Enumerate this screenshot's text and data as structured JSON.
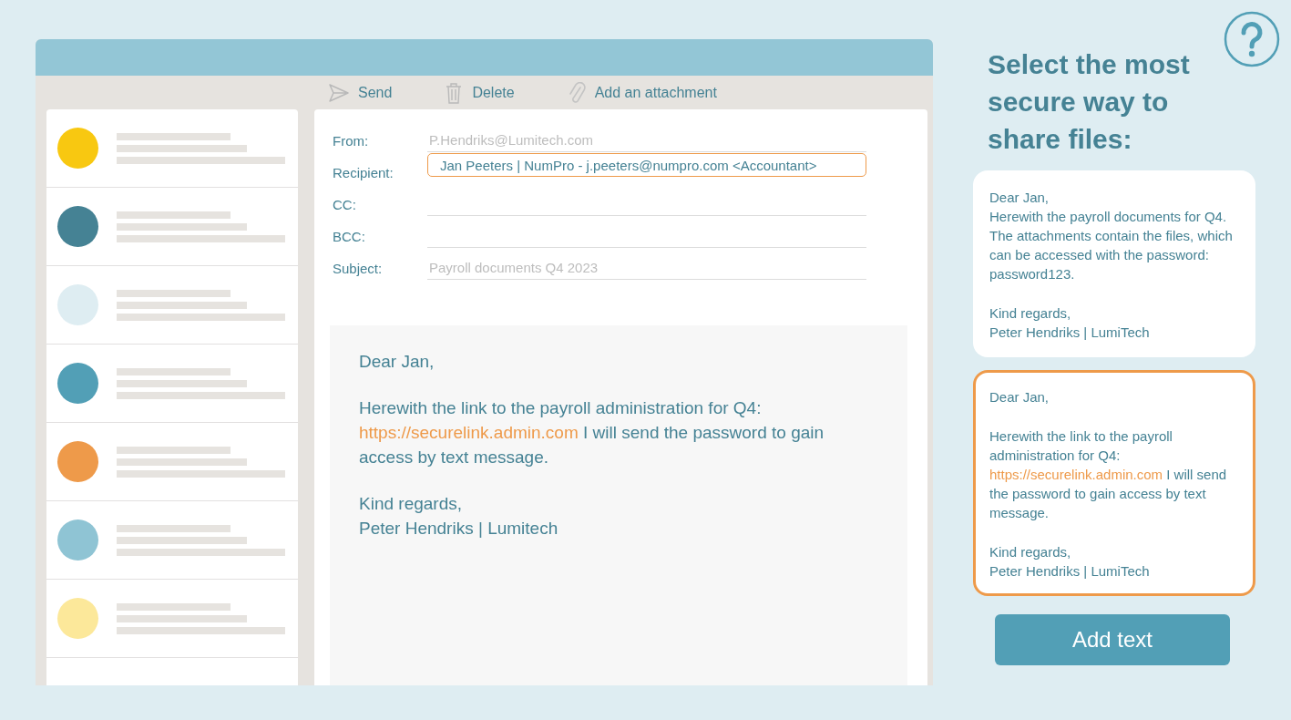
{
  "toolbar": [
    {
      "label": "Send",
      "kind": "send"
    },
    {
      "label": "Delete",
      "kind": "delete"
    },
    {
      "label": "Add an attachment",
      "kind": "attach"
    }
  ],
  "inbox": [
    {
      "color": "#f8c811"
    },
    {
      "color": "#458294"
    },
    {
      "color": "#deedf2"
    },
    {
      "color": "#529fb6"
    },
    {
      "color": "#ee9a4a"
    },
    {
      "color": "#8fc4d4"
    },
    {
      "color": "#fce89a"
    }
  ],
  "fields": [
    {
      "label": "From:",
      "placeholder": "P.Hendriks@Lumitech.com",
      "highlighted": false
    },
    {
      "label": "Recipient:",
      "value": "Jan Peeters | NumPro - j.peeters@numpro.com <Accountant>",
      "highlighted": true
    },
    {
      "label": "CC:",
      "highlighted": false
    },
    {
      "label": "BCC:",
      "highlighted": false
    },
    {
      "label": "Subject:",
      "placeholder": "Payroll documents Q4 2023",
      "highlighted": false
    }
  ],
  "body": [
    [
      {
        "text": "Dear Jan,"
      }
    ],
    [
      {
        "text": "Herewith the link to the payroll administration for Q4:",
        "link": "https://securelink.admin.com",
        "after": "I will send the password to gain access by text message."
      }
    ],
    [
      {
        "text": "Kind regards,"
      },
      {
        "text": "Peter Hendriks | Lumitech"
      }
    ]
  ],
  "question": "Select the most secure way to share files:",
  "options": [
    {
      "selected": false,
      "paragraphs": [
        [
          {
            "text": "Dear Jan,"
          },
          {
            "text": "Herewith the payroll documents for Q4. The attachments contain the files, which can be accessed with the password: password123."
          }
        ],
        [
          {
            "text": "Kind regards,"
          },
          {
            "text": "Peter Hendriks | LumiTech"
          }
        ]
      ]
    },
    {
      "selected": true,
      "paragraphs": [
        [
          {
            "text": "Dear Jan,"
          }
        ],
        [
          {
            "text": "Herewith the link to the payroll administration for Q4:",
            "link": "https://securelink.admin.com",
            "after": "I will send the password to gain access by text message."
          }
        ],
        [
          {
            "text": "Kind regards,"
          },
          {
            "text": "Peter Hendriks | LumiTech"
          }
        ]
      ]
    }
  ],
  "action": "Add text"
}
